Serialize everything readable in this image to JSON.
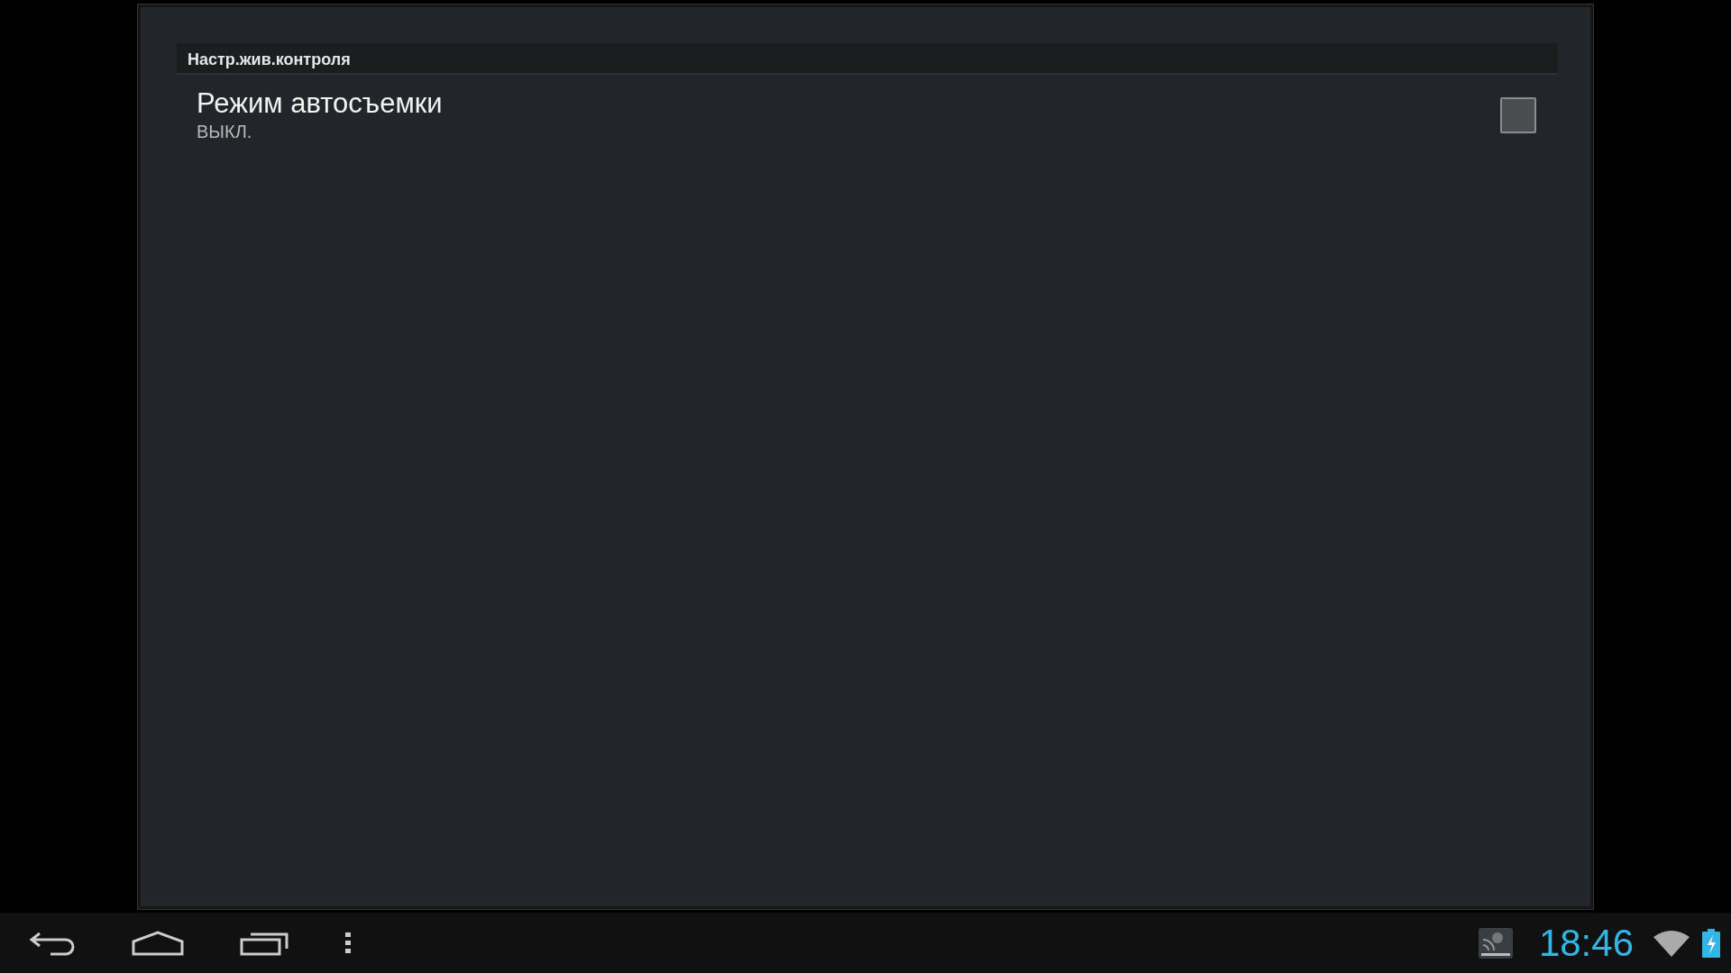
{
  "section": {
    "title": "Настр.жив.контроля"
  },
  "settings": [
    {
      "kind": "checkbox",
      "title": "Режим автосъемки",
      "summary": "ВЫКЛ.",
      "checked": false
    }
  ],
  "status_bar": {
    "time": "18:46"
  }
}
